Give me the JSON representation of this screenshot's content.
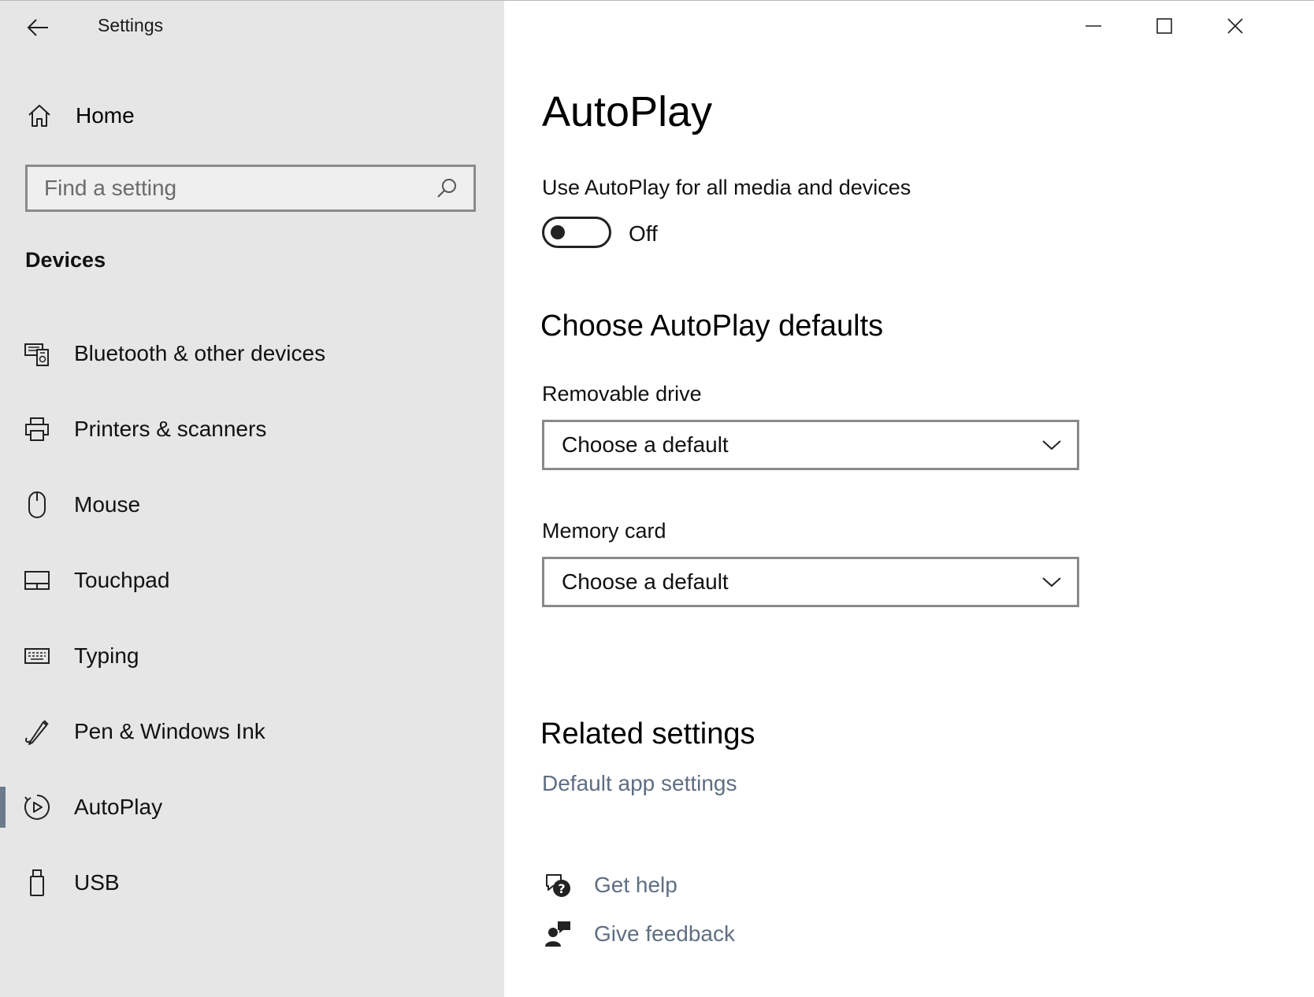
{
  "window": {
    "title": "Settings",
    "controls": {
      "minimize": "minimize-icon",
      "maximize": "maximize-icon",
      "close": "close-icon"
    }
  },
  "sidebar": {
    "home_label": "Home",
    "search_placeholder": "Find a setting",
    "section": "Devices",
    "items": [
      {
        "label": "Bluetooth & other devices",
        "icon": "bluetooth-devices-icon"
      },
      {
        "label": "Printers & scanners",
        "icon": "printer-icon"
      },
      {
        "label": "Mouse",
        "icon": "mouse-icon"
      },
      {
        "label": "Touchpad",
        "icon": "touchpad-icon"
      },
      {
        "label": "Typing",
        "icon": "keyboard-icon"
      },
      {
        "label": "Pen & Windows Ink",
        "icon": "pen-icon"
      },
      {
        "label": "AutoPlay",
        "icon": "autoplay-icon",
        "selected": true
      },
      {
        "label": "USB",
        "icon": "usb-icon"
      }
    ],
    "selected_accent": "#6b7a8c"
  },
  "main": {
    "title": "AutoPlay",
    "toggle_label": "Use AutoPlay for all media and devices",
    "toggle_state": "Off",
    "defaults_heading": "Choose AutoPlay defaults",
    "removable_drive_label": "Removable drive",
    "removable_drive_value": "Choose a default",
    "memory_card_label": "Memory card",
    "memory_card_value": "Choose a default",
    "related_heading": "Related settings",
    "default_app_link": "Default app settings",
    "get_help": "Get help",
    "give_feedback": "Give feedback",
    "link_color": "#5f6e82"
  }
}
